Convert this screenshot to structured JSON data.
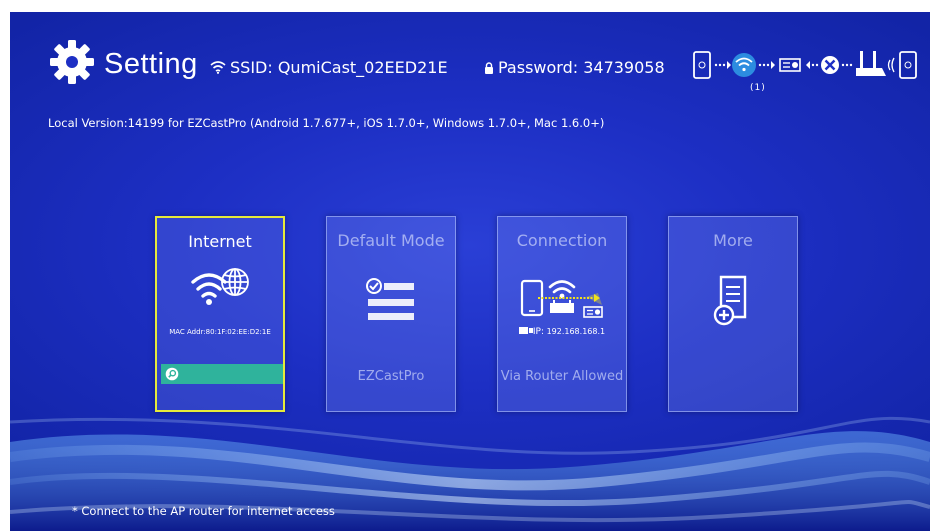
{
  "header": {
    "title": "Setting",
    "ssid": "SSID: QumiCast_02EED21E",
    "password": "Password: 34739058",
    "connected_count": "(1)"
  },
  "version_line": "Local Version:14199 for EZCastPro    (Android 1.7.677+, iOS 1.7.0+, Windows 1.7.0+, Mac 1.6.0+)",
  "tiles": [
    {
      "title": "Internet",
      "mac": "MAC Addr:80:1F:02:EE:D2:1E",
      "icon": "wifi-globe-icon"
    },
    {
      "title": "Default Mode",
      "sub": "EZCastPro",
      "icon": "mode-list-icon"
    },
    {
      "title": "Connection",
      "ip_label": "IP:",
      "ip_value": "192.168.168.1",
      "sub": "Via Router Allowed",
      "icon": "router-connection-icon"
    },
    {
      "title": "More",
      "icon": "document-add-icon"
    }
  ],
  "footer_note": "* Connect to the AP router for internet access",
  "colors": {
    "background": "#1d2fc4",
    "selected_border": "#e6ea3a",
    "search_bar": "#2fb39c"
  }
}
